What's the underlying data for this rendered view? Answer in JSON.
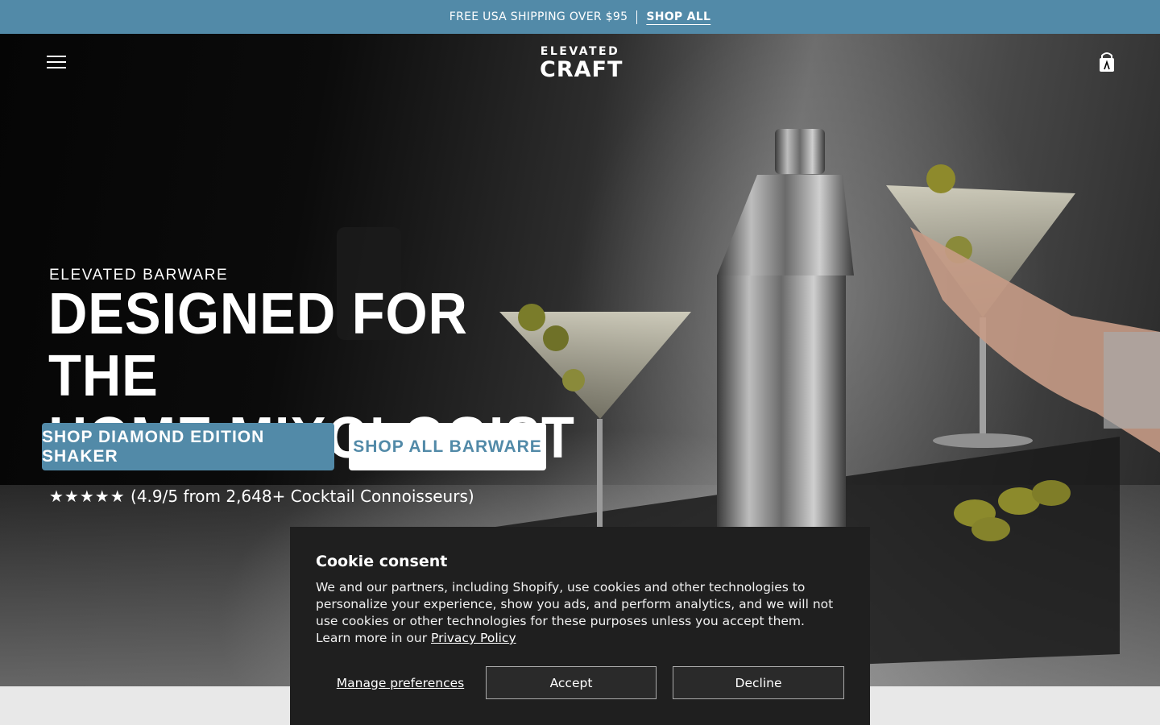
{
  "announcement": {
    "text": "FREE USA SHIPPING OVER $95",
    "link_label": "SHOP ALL"
  },
  "header": {
    "logo_line1": "ELEVATED",
    "logo_line2": "CRAFT",
    "menu_icon": "hamburger-menu-icon",
    "cart_icon": "shopping-bag-icon"
  },
  "hero": {
    "eyebrow": "ELEVATED BARWARE",
    "headline_line1": "DESIGNED FOR THE",
    "headline_line2": "HOME MIXOLOGIST",
    "primary_button": "SHOP DIAMOND EDITION SHAKER",
    "secondary_button": "SHOP ALL BARWARE",
    "rating_stars": "★★★★★",
    "rating_text": "(4.9/5 from 2,648+ Cocktail Connoisseurs)"
  },
  "cookie": {
    "title": "Cookie consent",
    "body": "We and our partners, including Shopify, use cookies and other technologies to personalize your experience, show you ads, and perform analytics, and we will not use cookies or other technologies for these purposes unless you accept them. Learn more in our ",
    "privacy_link": "Privacy Policy",
    "manage_label": "Manage preferences",
    "accept_label": "Accept",
    "decline_label": "Decline"
  },
  "colors": {
    "accent": "#528aa8",
    "cookie_bg": "#1f1f1f"
  }
}
